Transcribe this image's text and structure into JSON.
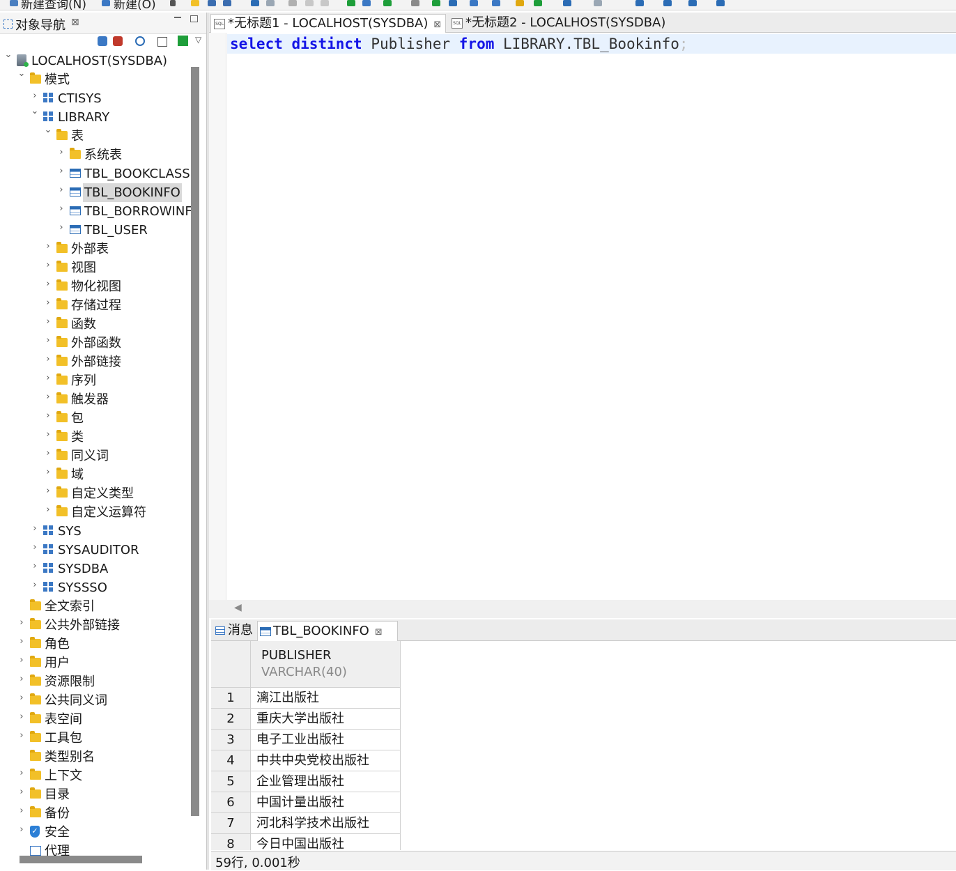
{
  "toolbar": {
    "new_query": "新建查询(N)",
    "new": "新建(O)"
  },
  "nav": {
    "title": "对象导航",
    "tree": [
      {
        "label": "LOCALHOST(SYSDBA)",
        "depth": 0,
        "icon": "database-icon",
        "chev": "v"
      },
      {
        "label": "模式",
        "depth": 1,
        "icon": "folder-icon",
        "chev": "v"
      },
      {
        "label": "CTISYS",
        "depth": 2,
        "icon": "schema-icon",
        "chev": ">"
      },
      {
        "label": "LIBRARY",
        "depth": 2,
        "icon": "schema-icon",
        "chev": "v"
      },
      {
        "label": "表",
        "depth": 3,
        "icon": "folder-icon",
        "chev": "v"
      },
      {
        "label": "系统表",
        "depth": 4,
        "icon": "folder-icon",
        "chev": ">"
      },
      {
        "label": "TBL_BOOKCLASS",
        "depth": 4,
        "icon": "table-icon",
        "chev": ">"
      },
      {
        "label": "TBL_BOOKINFO",
        "depth": 4,
        "icon": "table-icon",
        "chev": ">",
        "selected": true
      },
      {
        "label": "TBL_BORROWINF",
        "depth": 4,
        "icon": "table-icon",
        "chev": ">"
      },
      {
        "label": "TBL_USER",
        "depth": 4,
        "icon": "table-icon",
        "chev": ">"
      },
      {
        "label": "外部表",
        "depth": 3,
        "icon": "folder-icon",
        "chev": ">"
      },
      {
        "label": "视图",
        "depth": 3,
        "icon": "folder-icon",
        "chev": ">"
      },
      {
        "label": "物化视图",
        "depth": 3,
        "icon": "folder-icon",
        "chev": ">"
      },
      {
        "label": "存储过程",
        "depth": 3,
        "icon": "folder-icon",
        "chev": ">"
      },
      {
        "label": "函数",
        "depth": 3,
        "icon": "folder-icon",
        "chev": ">"
      },
      {
        "label": "外部函数",
        "depth": 3,
        "icon": "folder-icon",
        "chev": ">"
      },
      {
        "label": "外部链接",
        "depth": 3,
        "icon": "folder-icon",
        "chev": ">"
      },
      {
        "label": "序列",
        "depth": 3,
        "icon": "folder-icon",
        "chev": ">"
      },
      {
        "label": "触发器",
        "depth": 3,
        "icon": "folder-icon",
        "chev": ">"
      },
      {
        "label": "包",
        "depth": 3,
        "icon": "folder-icon",
        "chev": ">"
      },
      {
        "label": "类",
        "depth": 3,
        "icon": "folder-icon",
        "chev": ">"
      },
      {
        "label": "同义词",
        "depth": 3,
        "icon": "folder-icon",
        "chev": ">"
      },
      {
        "label": "域",
        "depth": 3,
        "icon": "folder-icon",
        "chev": ">"
      },
      {
        "label": "自定义类型",
        "depth": 3,
        "icon": "folder-icon",
        "chev": ">"
      },
      {
        "label": "自定义运算符",
        "depth": 3,
        "icon": "folder-icon",
        "chev": ">"
      },
      {
        "label": "SYS",
        "depth": 2,
        "icon": "schema-icon",
        "chev": ">"
      },
      {
        "label": "SYSAUDITOR",
        "depth": 2,
        "icon": "schema-icon",
        "chev": ">"
      },
      {
        "label": "SYSDBA",
        "depth": 2,
        "icon": "schema-icon",
        "chev": ">"
      },
      {
        "label": "SYSSSO",
        "depth": 2,
        "icon": "schema-icon",
        "chev": ">"
      },
      {
        "label": "全文索引",
        "depth": 1,
        "icon": "folder-icon",
        "chev": ""
      },
      {
        "label": "公共外部链接",
        "depth": 1,
        "icon": "folder-icon",
        "chev": ">"
      },
      {
        "label": "角色",
        "depth": 1,
        "icon": "folder-icon",
        "chev": ">"
      },
      {
        "label": "用户",
        "depth": 1,
        "icon": "folder-icon",
        "chev": ">"
      },
      {
        "label": "资源限制",
        "depth": 1,
        "icon": "folder-icon",
        "chev": ">"
      },
      {
        "label": "公共同义词",
        "depth": 1,
        "icon": "folder-icon",
        "chev": ">"
      },
      {
        "label": "表空间",
        "depth": 1,
        "icon": "folder-icon",
        "chev": ">"
      },
      {
        "label": "工具包",
        "depth": 1,
        "icon": "folder-icon",
        "chev": ">"
      },
      {
        "label": "类型别名",
        "depth": 1,
        "icon": "folder-icon",
        "chev": ""
      },
      {
        "label": "上下文",
        "depth": 1,
        "icon": "folder-icon",
        "chev": ">"
      },
      {
        "label": "目录",
        "depth": 1,
        "icon": "folder-icon",
        "chev": ">"
      },
      {
        "label": "备份",
        "depth": 1,
        "icon": "folder-icon",
        "chev": ">"
      },
      {
        "label": "安全",
        "depth": 1,
        "icon": "shield-icon",
        "chev": ">"
      },
      {
        "label": "代理",
        "depth": 1,
        "icon": "proxy-icon",
        "chev": ""
      }
    ]
  },
  "editor": {
    "tabs": [
      "*无标题1 - LOCALHOST(SYSDBA)",
      "*无标题2 - LOCALHOST(SYSDBA)"
    ],
    "sql": {
      "kw1": "select",
      "kw2": "distinct",
      "col": "Publisher",
      "kw3": "from",
      "tbl": "LIBRARY.TBL_Bookinfo",
      "semi": ";"
    }
  },
  "results": {
    "tabs": [
      "消息",
      "TBL_BOOKINFO"
    ],
    "column": {
      "name": "PUBLISHER",
      "type": "VARCHAR(40)"
    },
    "rows": [
      {
        "n": "1",
        "v": "漓江出版社"
      },
      {
        "n": "2",
        "v": "重庆大学出版社"
      },
      {
        "n": "3",
        "v": "电子工业出版社"
      },
      {
        "n": "4",
        "v": "中共中央党校出版社"
      },
      {
        "n": "5",
        "v": "企业管理出版社"
      },
      {
        "n": "6",
        "v": "中国计量出版社"
      },
      {
        "n": "7",
        "v": "河北科学技术出版社"
      },
      {
        "n": "8",
        "v": "今日中国出版社"
      }
    ],
    "status": "59行, 0.001秒"
  }
}
